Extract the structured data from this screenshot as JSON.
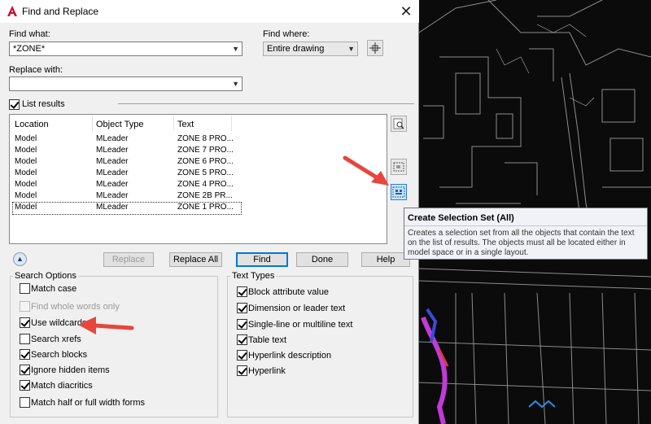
{
  "dialog": {
    "title": "Find and Replace",
    "close_glyph": "✕",
    "find_what_label": "Find what:",
    "find_what_value": "*ZONE*",
    "find_where_label": "Find where:",
    "find_where_value": "Entire drawing",
    "replace_with_label": "Replace with:",
    "replace_with_value": "",
    "list_results_label": "List results",
    "list_results_checked": true
  },
  "results": {
    "columns": [
      "Location",
      "Object Type",
      "Text"
    ],
    "rows": [
      {
        "location": "Model",
        "type": "MLeader",
        "text": "ZONE 8 PRO..."
      },
      {
        "location": "Model",
        "type": "MLeader",
        "text": "ZONE 7 PRO..."
      },
      {
        "location": "Model",
        "type": "MLeader",
        "text": "ZONE 6 PRO..."
      },
      {
        "location": "Model",
        "type": "MLeader",
        "text": "ZONE 5 PRO..."
      },
      {
        "location": "Model",
        "type": "MLeader",
        "text": "ZONE 4 PRO..."
      },
      {
        "location": "Model",
        "type": "MLeader",
        "text": "ZONE 2B PR..."
      },
      {
        "location": "Model",
        "type": "MLeader",
        "text": "ZONE 1 PRO..."
      }
    ]
  },
  "tooltip": {
    "title": "Create Selection Set (All)",
    "description": "Creates a selection set from all the objects that contain the text on the list of results. The objects must all be located either in model space or in a single layout."
  },
  "buttons": {
    "replace": "Replace",
    "replace_all": "Replace All",
    "find": "Find",
    "done": "Done",
    "help": "Help"
  },
  "search_options": {
    "title": "Search Options",
    "items": [
      {
        "label": "Match case",
        "checked": false,
        "disabled": false
      },
      {
        "label": "Find whole words only",
        "checked": false,
        "disabled": true
      },
      {
        "label": "Use wildcards",
        "checked": true,
        "disabled": false
      },
      {
        "label": "Search xrefs",
        "checked": false,
        "disabled": false
      },
      {
        "label": "Search blocks",
        "checked": true,
        "disabled": false
      },
      {
        "label": "Ignore hidden items",
        "checked": true,
        "disabled": false
      },
      {
        "label": "Match diacritics",
        "checked": true,
        "disabled": false
      },
      {
        "label": "Match half or full width forms",
        "checked": false,
        "disabled": false
      }
    ]
  },
  "text_types": {
    "title": "Text Types",
    "items": [
      {
        "label": "Block attribute value",
        "checked": true
      },
      {
        "label": "Dimension or leader text",
        "checked": true
      },
      {
        "label": "Single-line or multiline text",
        "checked": true
      },
      {
        "label": "Table text",
        "checked": true
      },
      {
        "label": "Hyperlink description",
        "checked": true
      },
      {
        "label": "Hyperlink",
        "checked": true
      }
    ]
  },
  "colors": {
    "annotation_arrow": "#e8453c",
    "cad_background": "#0b0b0b",
    "cad_lines": "#8c8c8c",
    "accent": "#0078d7"
  },
  "icons": [
    "autocad-logo-icon",
    "close-icon",
    "pick-point-icon",
    "zoom-to-icon",
    "create-selection-set-icon",
    "create-selection-set-all-icon",
    "collapse-icon",
    "chevron-down-icon"
  ]
}
